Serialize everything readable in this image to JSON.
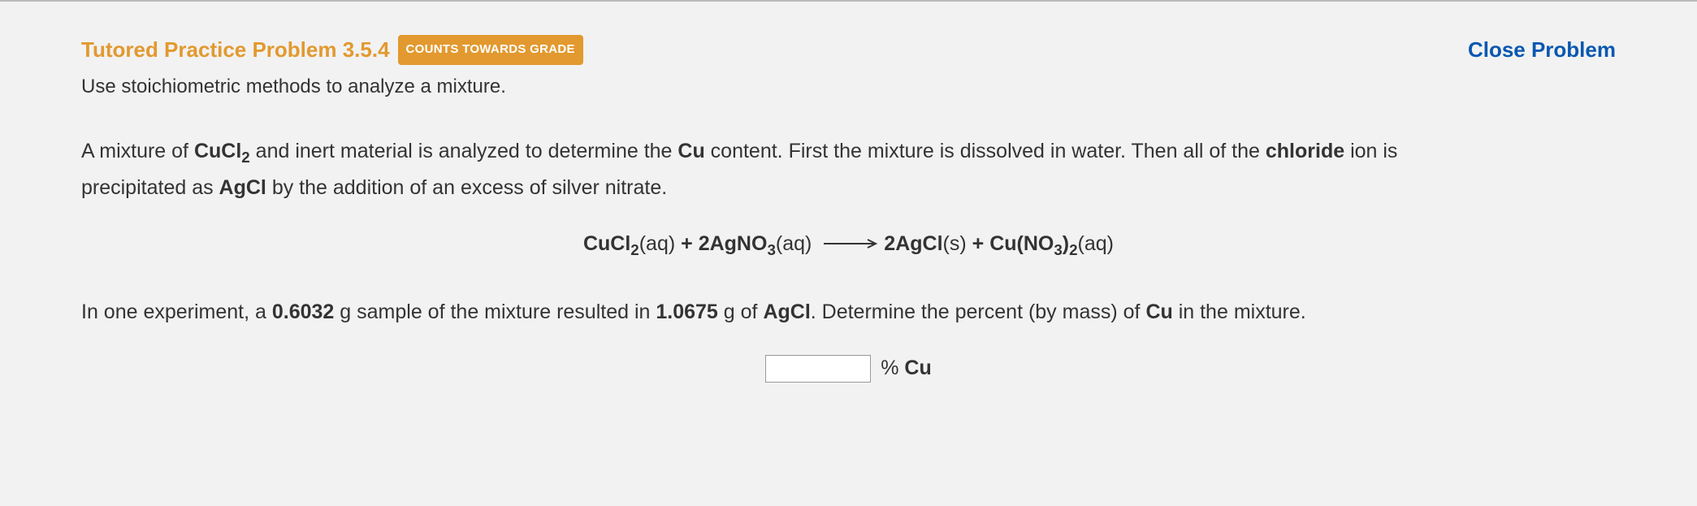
{
  "header": {
    "title": "Tutored Practice Problem 3.5.4",
    "badge": "COUNTS TOWARDS GRADE",
    "close": "Close Problem",
    "subtitle": "Use stoichiometric methods to analyze a mixture."
  },
  "paragraph1": {
    "t1": "A mixture of ",
    "f1": "CuCl",
    "s1": "2",
    "t2": " and inert material is analyzed to determine the ",
    "f2": "Cu",
    "t3": " content. First the mixture is dissolved in water. Then all of the ",
    "f3": "chloride",
    "t4": " ion is precipitated as ",
    "f4": "AgCl",
    "t5": " by the addition of an excess of silver nitrate."
  },
  "equation": {
    "r1a": "CuCl",
    "r1sub": "2",
    "r1state": "(aq)",
    "plus1": " + ",
    "r2coef": "2",
    "r2a": "AgNO",
    "r2sub": "3",
    "r2state": "(aq)",
    "p1coef": "2",
    "p1a": "AgCl",
    "p1state": "(s)",
    "plus2": " + ",
    "p2a": "Cu(NO",
    "p2sub": "3",
    "p2b": ")",
    "p2sub2": "2",
    "p2state": "(aq)"
  },
  "paragraph2": {
    "t1": "In one experiment, a ",
    "v1": "0.6032",
    "t2": " g sample of the mixture resulted in ",
    "v2": "1.0675",
    "t3": " g of ",
    "f1": "AgCl",
    "t4": ". Determine the percent (by mass) of ",
    "f2": "Cu",
    "t5": " in the mixture."
  },
  "answer": {
    "value": "",
    "unit_prefix": "% ",
    "unit_bold": "Cu"
  }
}
